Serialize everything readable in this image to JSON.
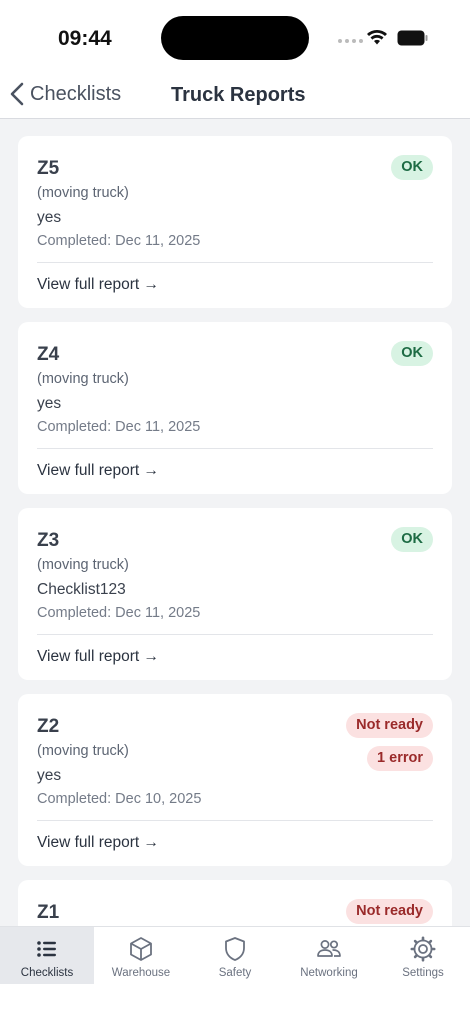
{
  "status_bar": {
    "time": "09:44"
  },
  "nav": {
    "back_label": "Checklists",
    "title": "Truck Reports"
  },
  "reports": [
    {
      "id": "Z5",
      "vehicle": "(moving truck)",
      "note": "yes",
      "completed": "Completed: Dec 11, 2025",
      "link": "View full report →",
      "badges": [
        {
          "label": "OK",
          "kind": "ok"
        }
      ]
    },
    {
      "id": "Z4",
      "vehicle": "(moving truck)",
      "note": "yes",
      "completed": "Completed: Dec 11, 2025",
      "link": "View full report →",
      "badges": [
        {
          "label": "OK",
          "kind": "ok"
        }
      ]
    },
    {
      "id": "Z3",
      "vehicle": "(moving truck)",
      "note": "Checklist123",
      "completed": "Completed: Dec 11, 2025",
      "link": "View full report →",
      "badges": [
        {
          "label": "OK",
          "kind": "ok"
        }
      ]
    },
    {
      "id": "Z2",
      "vehicle": "(moving truck)",
      "note": "yes",
      "completed": "Completed: Dec 10, 2025",
      "link": "View full report →",
      "badges": [
        {
          "label": "Not ready",
          "kind": "bad"
        },
        {
          "label": "1 error",
          "kind": "bad"
        }
      ]
    },
    {
      "id": "Z1",
      "vehicle": "",
      "note": "",
      "completed": "",
      "link": "",
      "badges": [
        {
          "label": "Not ready",
          "kind": "bad"
        }
      ]
    }
  ],
  "tabs": [
    {
      "label": "Checklists",
      "icon": "list-icon",
      "active": true
    },
    {
      "label": "Warehouse",
      "icon": "box-icon",
      "active": false
    },
    {
      "label": "Safety",
      "icon": "shield-icon",
      "active": false
    },
    {
      "label": "Networking",
      "icon": "users-icon",
      "active": false
    },
    {
      "label": "Settings",
      "icon": "gear-icon",
      "active": false
    }
  ],
  "colors": {
    "ok_bg": "#d8f3e3",
    "ok_text": "#1d6b44",
    "bad_bg": "#fbe1e1",
    "bad_text": "#9a2a2a"
  }
}
